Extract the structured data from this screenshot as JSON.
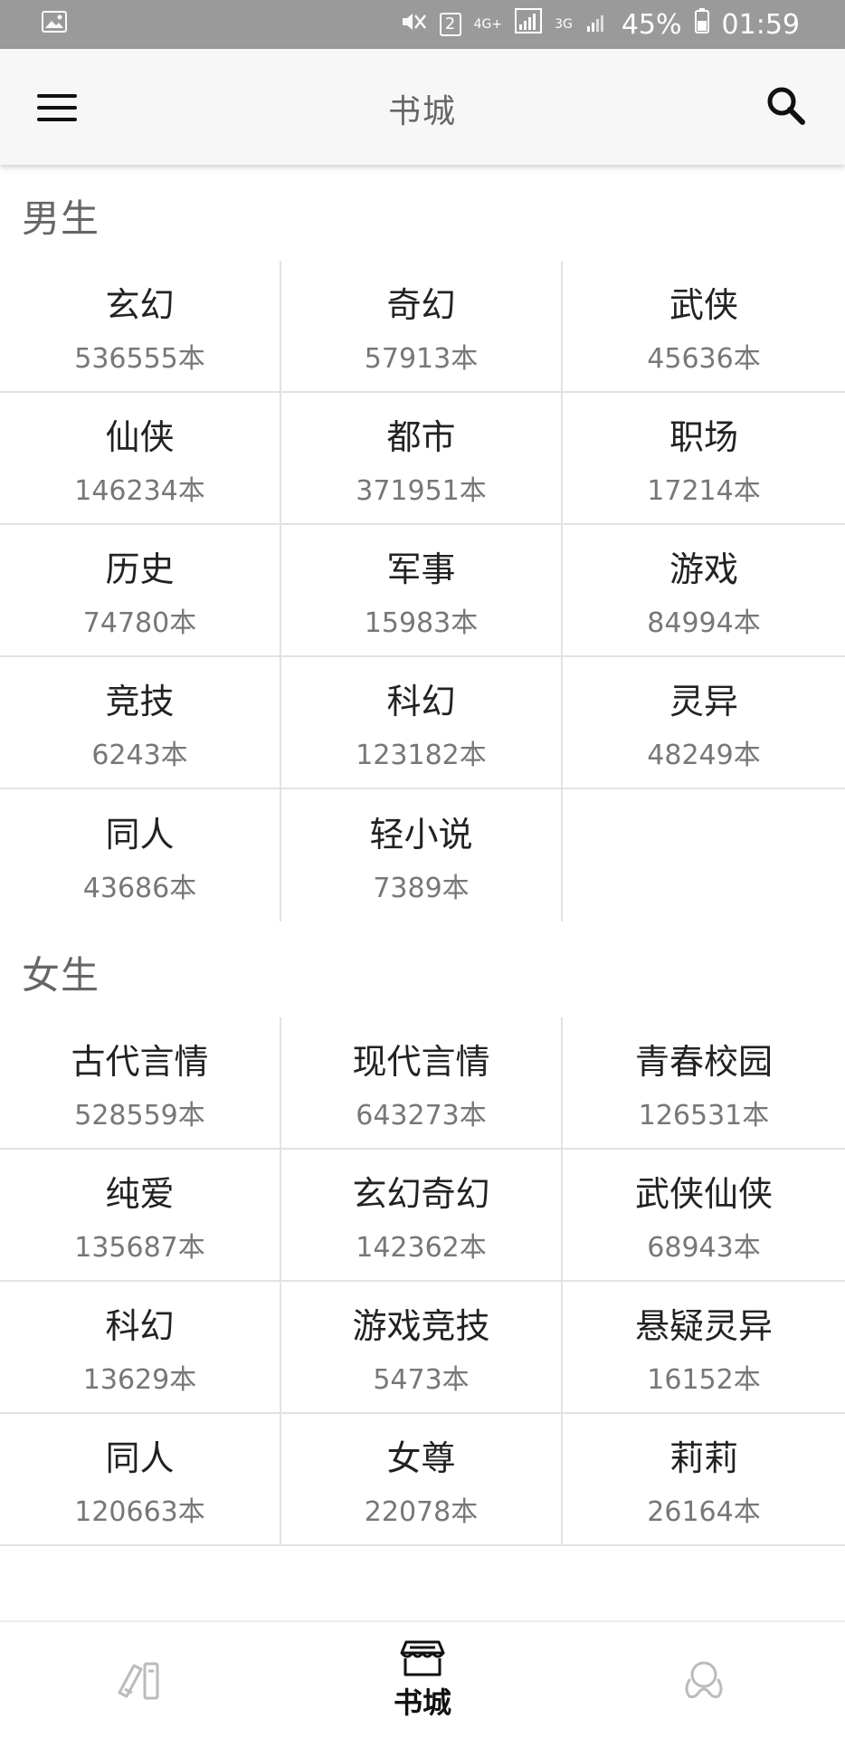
{
  "status": {
    "battery": "45%",
    "time": "01:59",
    "sim_badge": "2",
    "network_4g": "4G+",
    "network_3g": "3G"
  },
  "appbar": {
    "title": "书城"
  },
  "male": {
    "title": "男生",
    "items": [
      {
        "name": "玄幻",
        "count": "536555本"
      },
      {
        "name": "奇幻",
        "count": "57913本"
      },
      {
        "name": "武侠",
        "count": "45636本"
      },
      {
        "name": "仙侠",
        "count": "146234本"
      },
      {
        "name": "都市",
        "count": "371951本"
      },
      {
        "name": "职场",
        "count": "17214本"
      },
      {
        "name": "历史",
        "count": "74780本"
      },
      {
        "name": "军事",
        "count": "15983本"
      },
      {
        "name": "游戏",
        "count": "84994本"
      },
      {
        "name": "竞技",
        "count": "6243本"
      },
      {
        "name": "科幻",
        "count": "123182本"
      },
      {
        "name": "灵异",
        "count": "48249本"
      },
      {
        "name": "同人",
        "count": "43686本"
      },
      {
        "name": "轻小说",
        "count": "7389本"
      }
    ]
  },
  "female": {
    "title": "女生",
    "items": [
      {
        "name": "古代言情",
        "count": "528559本"
      },
      {
        "name": "现代言情",
        "count": "643273本"
      },
      {
        "name": "青春校园",
        "count": "126531本"
      },
      {
        "name": "纯爱",
        "count": "135687本"
      },
      {
        "name": "玄幻奇幻",
        "count": "142362本"
      },
      {
        "name": "武侠仙侠",
        "count": "68943本"
      },
      {
        "name": "科幻",
        "count": "13629本"
      },
      {
        "name": "游戏竞技",
        "count": "5473本"
      },
      {
        "name": "悬疑灵异",
        "count": "16152本"
      },
      {
        "name": "同人",
        "count": "120663本"
      },
      {
        "name": "女尊",
        "count": "22078本"
      },
      {
        "name": "莉莉",
        "count": "26164本"
      }
    ]
  },
  "bottom_nav": {
    "items": [
      {
        "icon": "bookshelf-icon",
        "label": ""
      },
      {
        "icon": "store-icon",
        "label": "书城"
      },
      {
        "icon": "discover-icon",
        "label": ""
      }
    ]
  }
}
